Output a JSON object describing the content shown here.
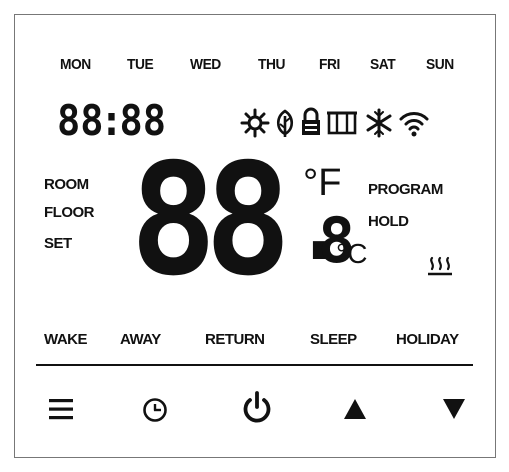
{
  "days": [
    "MON",
    "TUE",
    "WED",
    "THU",
    "FRI",
    "SAT",
    "SUN"
  ],
  "clock": {
    "hours": "88",
    "separator": ":",
    "minutes": "88"
  },
  "status_icons": [
    "sun-icon",
    "leaf-icon",
    "lock-icon",
    "window-icon",
    "snowflake-icon",
    "wifi-icon"
  ],
  "left_labels": {
    "room": "ROOM",
    "floor": "FLOOR",
    "set": "SET"
  },
  "temperature": {
    "integer": "88",
    "decimal_point": ".",
    "decimal": "8",
    "unit_f": "°F",
    "unit_c": "°C"
  },
  "right_labels": {
    "program": "PROGRAM",
    "hold": "HOLD"
  },
  "heating_indicator": "heat-waves-icon",
  "modes": [
    "WAKE",
    "AWAY",
    "RETURN",
    "SLEEP",
    "HOLIDAY"
  ],
  "buttons": [
    "menu-icon",
    "clock-icon",
    "power-icon",
    "up-arrow-icon",
    "down-arrow-icon"
  ],
  "colors": {
    "lcd": "#111111",
    "border": "#777777",
    "background": "#ffffff"
  }
}
